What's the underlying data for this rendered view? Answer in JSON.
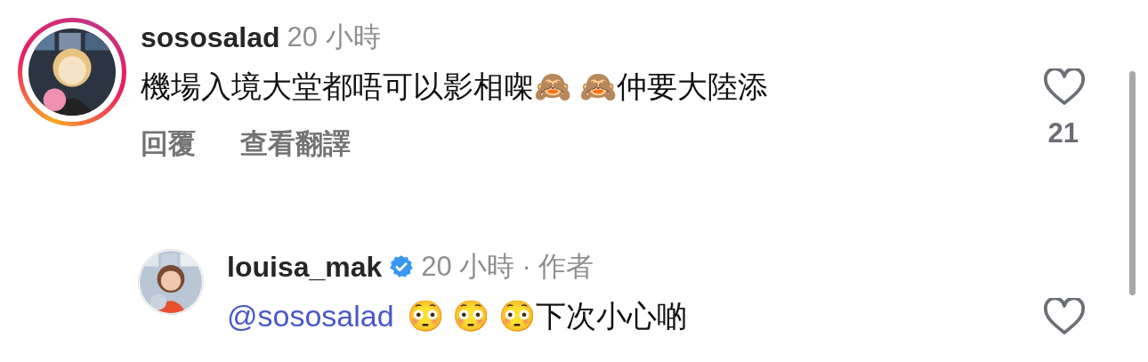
{
  "comments": [
    {
      "avatar": {
        "kind": "picture",
        "story_ring": true
      },
      "username": "sososalad",
      "verified": false,
      "time": "20 小時",
      "text": "機場入境大堂都唔可以影相㗎🙈 🙈仲要大陸添",
      "actions": [
        "回覆",
        "查看翻譯"
      ],
      "likes": "21"
    },
    {
      "avatar": {
        "kind": "picture",
        "story_ring": false
      },
      "username": "louisa_mak",
      "verified": true,
      "time": "20 小時",
      "separator": "·",
      "author_label": "作者",
      "mention": "@sososalad",
      "text": "😳 😳 😳下次小心啲"
    }
  ]
}
